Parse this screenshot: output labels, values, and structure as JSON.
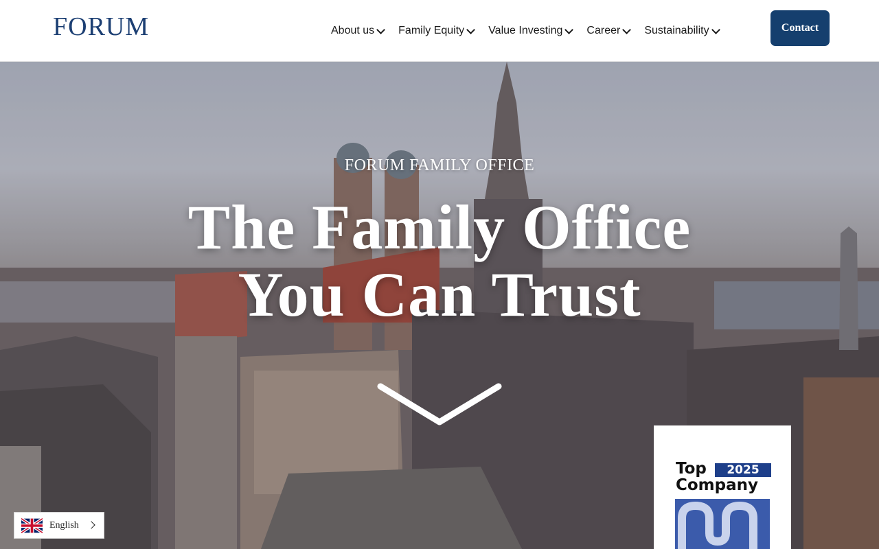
{
  "header": {
    "logo_text": "FORUM",
    "nav": [
      {
        "label": "About us"
      },
      {
        "label": "Family Equity"
      },
      {
        "label": "Value Investing"
      },
      {
        "label": "Career"
      },
      {
        "label": "Sustainability"
      }
    ],
    "contact_label": "Contact"
  },
  "hero": {
    "eyebrow": "FORUM FAMILY OFFICE",
    "headline_line1": "The Family Office",
    "headline_line2": "You Can Trust"
  },
  "badge": {
    "top": "Top",
    "year": "2025",
    "company": "Company"
  },
  "language": {
    "selected": "English"
  },
  "colors": {
    "brand": "#1c3f73",
    "contact_bg": "#153f6e",
    "badge_blue": "#1e3f8a"
  }
}
